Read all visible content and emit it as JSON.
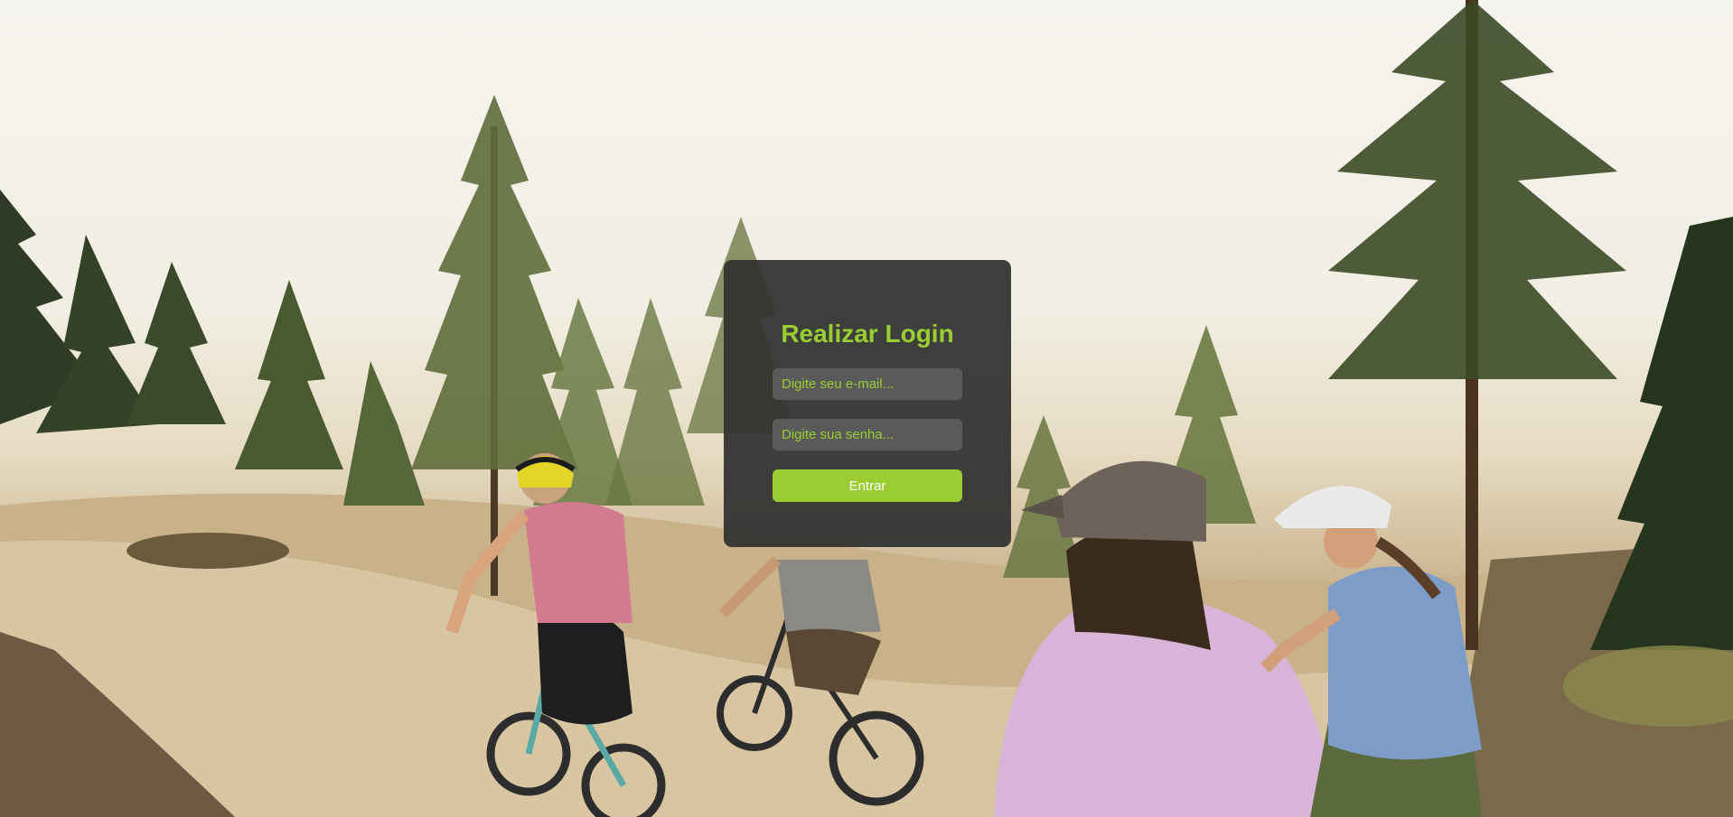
{
  "login": {
    "title": "Realizar Login",
    "email_placeholder": "Digite seu e-mail...",
    "password_placeholder": "Digite sua senha...",
    "submit_label": "Entrar"
  },
  "colors": {
    "accent": "#9acd32",
    "card": "#303030",
    "field": "#5a5a5a"
  }
}
